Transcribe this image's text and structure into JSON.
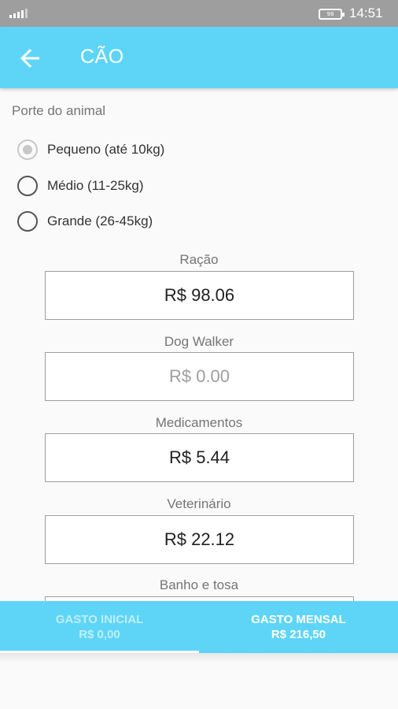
{
  "status_bar": {
    "time": "14:51",
    "battery": "98",
    "icons": [
      "signal-icon",
      "battery-icon"
    ]
  },
  "app_bar": {
    "title": "CÃO",
    "back_icon": "arrow-left-icon"
  },
  "porte": {
    "label": "Porte do animal",
    "options": [
      {
        "label": "Pequeno (até 10kg)",
        "checked": true
      },
      {
        "label": "Médio (11-25kg)",
        "checked": false
      },
      {
        "label": "Grande (26-45kg)",
        "checked": false
      }
    ]
  },
  "fields": [
    {
      "label": "Ração",
      "value": "R$ 98.06"
    },
    {
      "label": "Dog Walker",
      "value": "",
      "placeholder": "R$ 0.00"
    },
    {
      "label": "Medicamentos",
      "value": "R$ 5.44"
    },
    {
      "label": "Veterinário",
      "value": "R$ 22.12"
    },
    {
      "label": "Banho e tosa",
      "value": ""
    }
  ],
  "tabs": [
    {
      "title": "GASTO INICIAL",
      "value": "R$ 0,00",
      "selected": false
    },
    {
      "title": "GASTO MENSAL",
      "value": "R$ 216,50",
      "selected": true
    }
  ],
  "colors": {
    "primary": "#5ed5f7",
    "status_bar": "#9e9e9e"
  }
}
